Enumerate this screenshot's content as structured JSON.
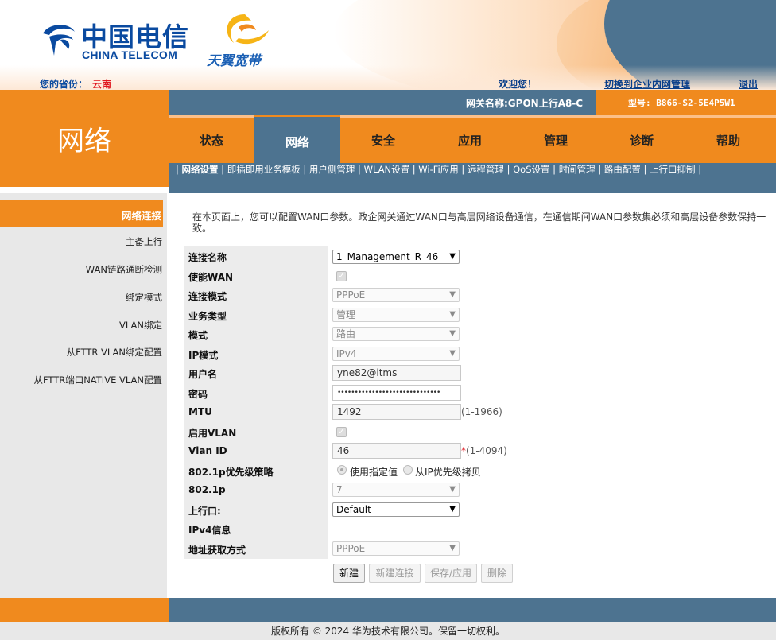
{
  "header": {
    "brand_zh": "中国电信",
    "brand_en": "CHINA TELECOM",
    "sub_brand": "天翼宽带",
    "province_label": "您的省份：",
    "province_value": "云南",
    "welcome": "欢迎您！",
    "switch_link": "切换到企业内网管理",
    "logout": "退出",
    "gateway_name": "网关名称:GPON上行A8-C",
    "model": "型号: B866-S2-5E4P5W1"
  },
  "page_title": "网络",
  "nav": {
    "tabs": [
      "状态",
      "网络",
      "安全",
      "应用",
      "管理",
      "诊断",
      "帮助"
    ],
    "active": "网络"
  },
  "subnav": {
    "active": "网络设置",
    "items": [
      "即插即用业务模板",
      "用户侧管理",
      "WLAN设置",
      "Wi-Fi应用",
      "远程管理",
      "QoS设置",
      "时间管理",
      "路由配置",
      "上行口抑制"
    ]
  },
  "sidebar": {
    "items": [
      "网络连接",
      "主备上行",
      "WAN链路通断检测",
      "绑定模式",
      "VLAN绑定",
      "从FTTR VLAN绑定配置",
      "从FTTR端口NATIVE VLAN配置"
    ]
  },
  "main": {
    "description": "在本页面上，您可以配置WAN口参数。政企网关通过WAN口与高层网络设备通信，在通信期间WAN口参数集必须和高层设备参数保持一致。",
    "form": {
      "connection_name": {
        "label": "连接名称",
        "value": "1_Management_R_46"
      },
      "enable_wan": {
        "label": "使能WAN",
        "checked": true
      },
      "conn_mode": {
        "label": "连接模式",
        "value": "PPPoE"
      },
      "service_type": {
        "label": "业务类型",
        "value": "管理"
      },
      "mode": {
        "label": "模式",
        "value": "路由"
      },
      "ip_mode": {
        "label": "IP模式",
        "value": "IPv4"
      },
      "username": {
        "label": "用户名",
        "value": "yne82@itms"
      },
      "password": {
        "label": "密码",
        "value": "••••••••••••••••••••••••••••••"
      },
      "mtu": {
        "label": "MTU",
        "value": "1492",
        "hint": "(1-1966)"
      },
      "enable_vlan": {
        "label": "启用VLAN",
        "checked": true
      },
      "vlan_id": {
        "label": "Vlan ID",
        "value": "46",
        "required": "*",
        "hint": "(1-4094)"
      },
      "priority_policy": {
        "label": "802.1p优先级策略",
        "option1": "使用指定值",
        "option2": "从IP优先级拷贝"
      },
      "p8021": {
        "label": "802.1p",
        "value": "7"
      },
      "uplink": {
        "label": "上行口:",
        "value": "Default"
      },
      "ipv4_info": {
        "label": "IPv4信息"
      },
      "addr_method": {
        "label": "地址获取方式",
        "value": "PPPoE"
      }
    },
    "buttons": {
      "new": "新建",
      "new_conn": "新建连接",
      "save": "保存/应用",
      "delete": "删除"
    }
  },
  "footer": {
    "copyright": "版权所有 © 2024 华为技术有限公司。保留一切权利。"
  },
  "colors": {
    "orange": "#f08a1e",
    "steel_blue": "#4d7390",
    "brand_blue": "#0a4aa0",
    "red": "#e0161e"
  }
}
